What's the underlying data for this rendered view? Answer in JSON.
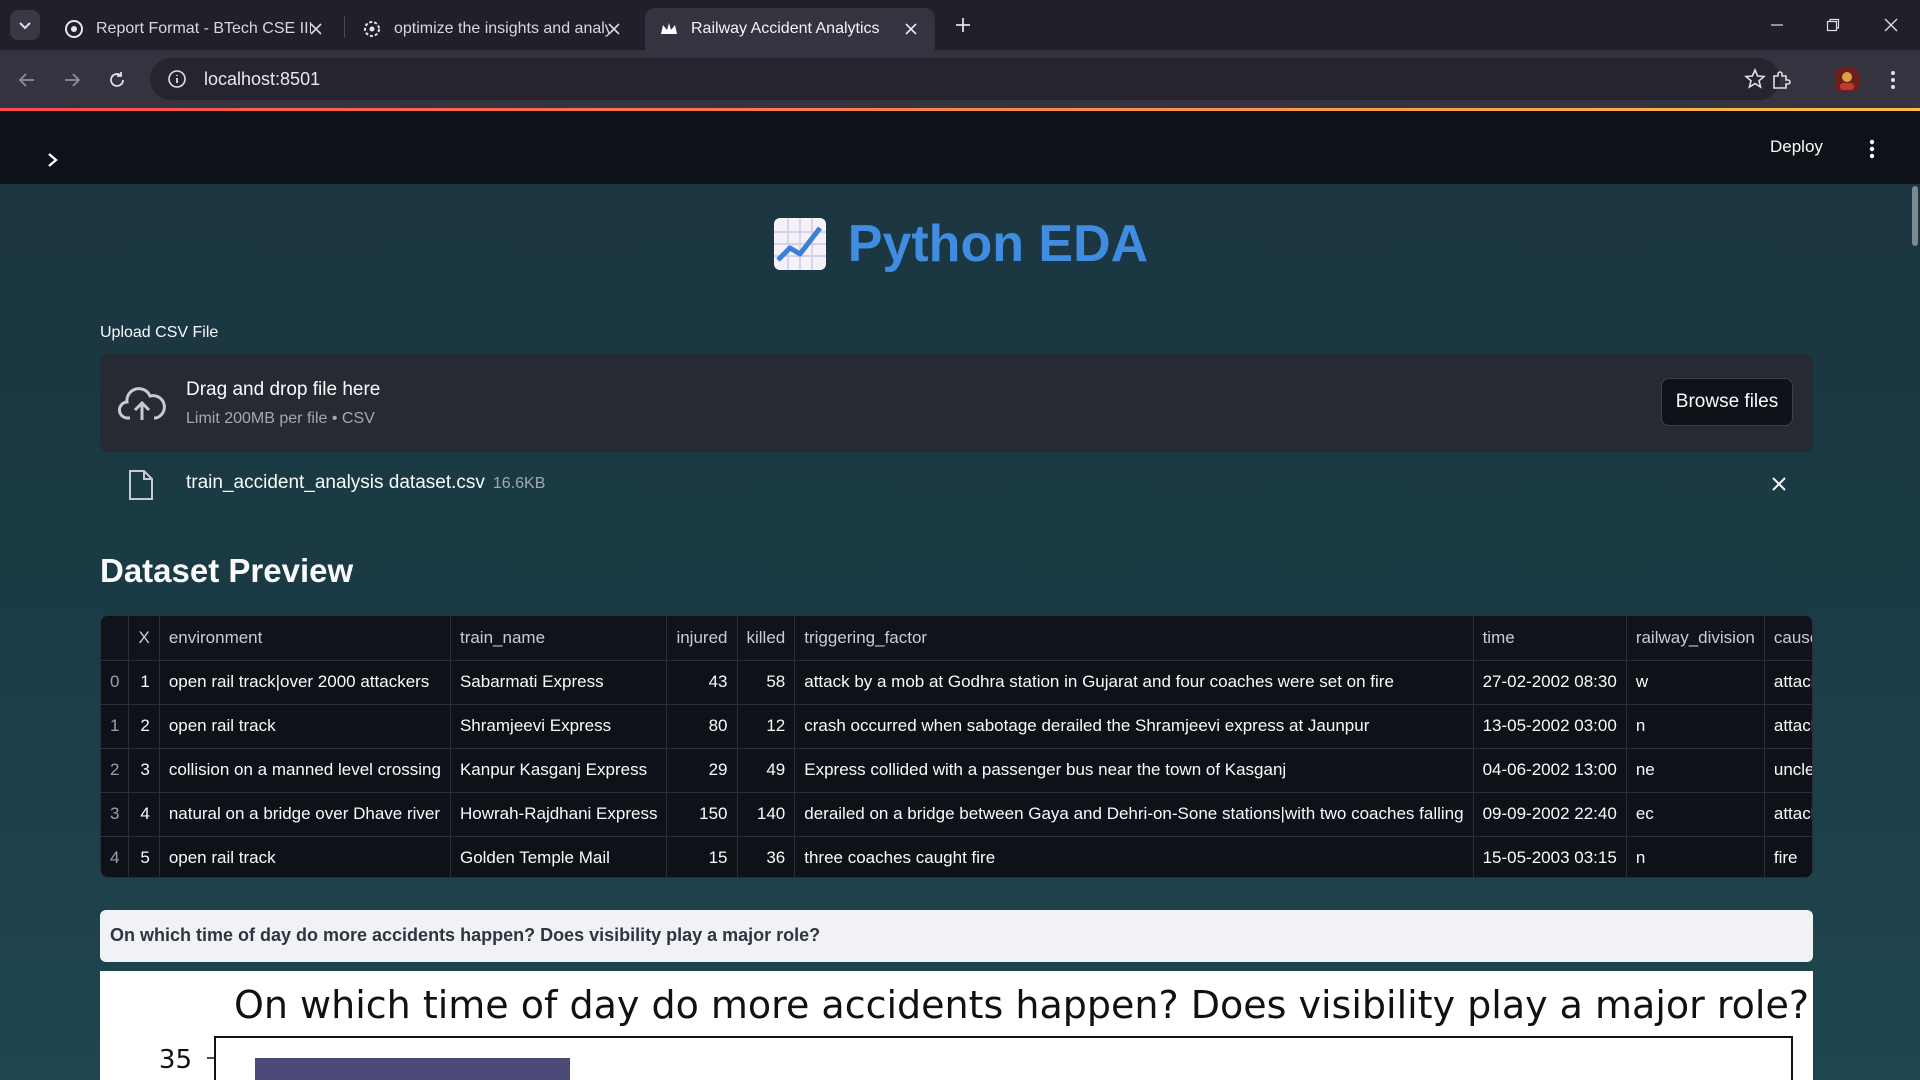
{
  "browser": {
    "tabs": [
      {
        "title": "Report Format - BTech CSE IIIT | "
      },
      {
        "title": "optimize the insights and analy"
      },
      {
        "title": "Railway Accident Analytics"
      }
    ],
    "url": "localhost:8501"
  },
  "app": {
    "deploy_label": "Deploy",
    "page_title": "Python EDA",
    "upload": {
      "label": "Upload CSV File",
      "drop_text": "Drag and drop file here",
      "limit_text": "Limit 200MB per file • CSV",
      "browse_label": "Browse files"
    },
    "file": {
      "name": "train_accident_analysis dataset.csv",
      "size": "16.6KB"
    },
    "preview_heading": "Dataset Preview",
    "table": {
      "columns": [
        "",
        "X",
        "environment",
        "train_name",
        "injured",
        "killed",
        "triggering_factor",
        "time",
        "railway_division",
        "cause"
      ],
      "rows": [
        [
          "0",
          "1",
          "open rail track|over 2000 attackers",
          "Sabarmati Express",
          "43",
          "58",
          "attack by a mob at Godhra station in Gujarat and four coaches were set on fire",
          "27-02-2002 08:30",
          "w",
          "attack"
        ],
        [
          "1",
          "2",
          "open rail track",
          "Shramjeevi Express",
          "80",
          "12",
          " crash occurred when sabotage derailed the Shramjeevi express at Jaunpur",
          "13-05-2002 03:00",
          "n",
          "attack"
        ],
        [
          "2",
          "3",
          "collision on a manned level crossing",
          "Kanpur Kasganj Express",
          "29",
          "49",
          "Express collided with a passenger bus near the town of Kasganj",
          "04-06-2002 13:00",
          "ne",
          "unclear"
        ],
        [
          "3",
          "4",
          "natural on a bridge over Dhave river",
          "Howrah-Rajdhani Express",
          "150",
          "140",
          "derailed on a bridge between Gaya and Dehri-on-Sone stations|with two coaches falling",
          "09-09-2002 22:40",
          "ec",
          "attack"
        ],
        [
          "4",
          "5",
          "open rail track",
          "Golden Temple Mail",
          "15",
          "36",
          "three coaches caught fire",
          "15-05-2003 03:15",
          "n",
          "fire"
        ]
      ]
    },
    "question": "On which time of day do more accidents happen? Does visibility play a major role?"
  },
  "chart_data": {
    "type": "bar",
    "title": "On which time of day do more accidents happen? Does visibility play a major role?",
    "y_tick_visible": "35",
    "bar_color": "#4c4b78"
  }
}
